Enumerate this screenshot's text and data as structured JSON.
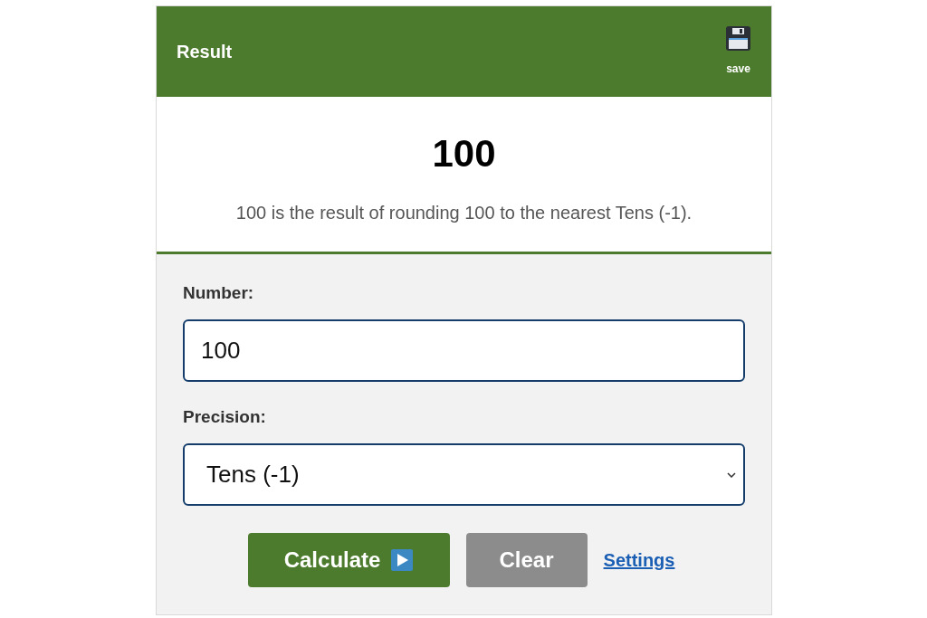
{
  "header": {
    "title": "Result",
    "save_label": "save"
  },
  "result": {
    "value": "100",
    "explanation": "100 is the result of rounding 100 to the nearest Tens (-1)."
  },
  "form": {
    "fields": [
      {
        "kind": "input",
        "label": "Number:",
        "value": "100"
      },
      {
        "kind": "select",
        "label": "Precision:",
        "value": "Tens (-1)"
      }
    ],
    "buttons": [
      {
        "kind": "primary",
        "label": "Calculate"
      },
      {
        "kind": "secondary",
        "label": "Clear"
      },
      {
        "kind": "link",
        "label": "Settings"
      }
    ]
  }
}
